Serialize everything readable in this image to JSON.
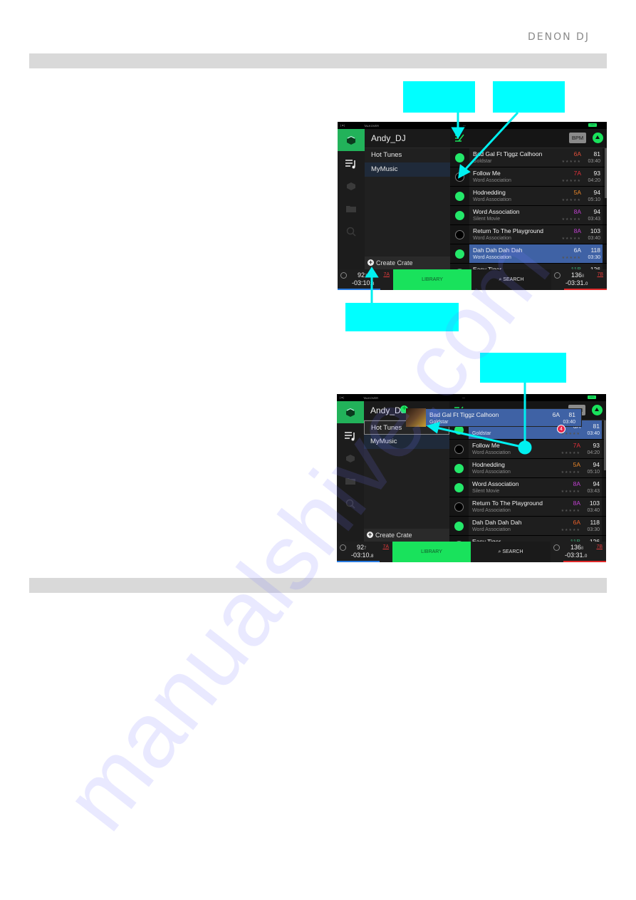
{
  "brand": {
    "logo": "DENON DJ"
  },
  "screens": [
    {
      "status": {
        "left": "|◂|",
        "talkover": "TALKOVER",
        "middle": "—",
        "battery": "100%"
      },
      "user": "Andy_DJ",
      "crates": [
        {
          "label": "Hot Tunes"
        },
        {
          "label": "MyMusic"
        }
      ],
      "create_crate": "Create Crate",
      "bpm_sort": "BPM",
      "tracks": [
        {
          "title": "Bad Gal Ft Tiggz Calhoon",
          "artist": "Goldstar",
          "key": "6A",
          "key_color": "#e0503a",
          "bpm": "81",
          "length": "03:40",
          "checked": true
        },
        {
          "title": "Follow Me",
          "artist": "Word Association",
          "key": "7A",
          "key_color": "#e0303a",
          "bpm": "93",
          "length": "04:20",
          "checked": false
        },
        {
          "title": "Hodnedding",
          "artist": "Word Association",
          "key": "5A",
          "key_color": "#e8862a",
          "bpm": "94",
          "length": "05:10",
          "checked": true
        },
        {
          "title": "Word Association",
          "artist": "Silent Movie",
          "key": "8A",
          "key_color": "#c040d0",
          "bpm": "94",
          "length": "03:43",
          "checked": true
        },
        {
          "title": "Return To The Playground",
          "artist": "Word Association",
          "key": "8A",
          "key_color": "#c040d0",
          "bpm": "103",
          "length": "03:40",
          "checked": false
        },
        {
          "title": "Dah Dah Dah Dah",
          "artist": "Word Association",
          "key": "6A",
          "key_color": "#e6ecf8",
          "bpm": "118",
          "length": "03:30",
          "checked": true,
          "selected": true
        },
        {
          "title": "Easy Tiger",
          "artist": "",
          "key": "11B",
          "key_color": "#3aa070",
          "bpm": "126",
          "length": "",
          "checked": false
        }
      ],
      "deck_left": {
        "bpm": "92",
        "bpm_dec": "7",
        "time": "-03:10.",
        "time_dec": "8",
        "key": "7A",
        "bar_color": "#2a7be0"
      },
      "library": "LIBRARY",
      "search": "SEARCH",
      "deck_right": {
        "bpm": "136",
        "bpm_dec": "8",
        "time": "-03:31.",
        "time_dec": "0",
        "key": "7B",
        "bar_color": "#e02a2a"
      }
    },
    {
      "status": {
        "left": "|◂|",
        "talkover": "TALKOVER",
        "middle": "—",
        "battery": "100%"
      },
      "user": "Andy_DJ",
      "crates": [
        {
          "label": "Hot Tunes"
        },
        {
          "label": "MyMusic"
        }
      ],
      "create_crate": "Create Crate",
      "bpm_sort": "BPM",
      "drag": {
        "title": "Bad Gal Ft Tiggz Calhoon",
        "artist": "Goldstar",
        "key": "6A",
        "bpm": "81",
        "length": "03:40",
        "count": "4"
      },
      "tracks": [
        {
          "title": "",
          "artist": "Goldstar",
          "key": "6A",
          "key_color": "#e6ecf8",
          "bpm": "81",
          "length": "03:40",
          "checked": true,
          "selected": true
        },
        {
          "title": "Follow Me",
          "artist": "Word Association",
          "key": "7A",
          "key_color": "#e0303a",
          "bpm": "93",
          "length": "04:20",
          "checked": false
        },
        {
          "title": "Hodnedding",
          "artist": "Word Association",
          "key": "5A",
          "key_color": "#e8862a",
          "bpm": "94",
          "length": "05:10",
          "checked": true
        },
        {
          "title": "Word Association",
          "artist": "Silent Movie",
          "key": "8A",
          "key_color": "#c040d0",
          "bpm": "94",
          "length": "03:43",
          "checked": true
        },
        {
          "title": "Return To The Playground",
          "artist": "Word Association",
          "key": "8A",
          "key_color": "#c040d0",
          "bpm": "103",
          "length": "03:40",
          "checked": false
        },
        {
          "title": "Dah Dah Dah Dah",
          "artist": "Word Association",
          "key": "6A",
          "key_color": "#e8602a",
          "bpm": "118",
          "length": "03:30",
          "checked": true
        },
        {
          "title": "Easy Tiger",
          "artist": "",
          "key": "11B",
          "key_color": "#3aa070",
          "bpm": "126",
          "length": "",
          "checked": false
        }
      ],
      "deck_left": {
        "bpm": "92",
        "bpm_dec": "7",
        "time": "-03:10.",
        "time_dec": "8",
        "key": "7A",
        "bar_color": "#2a7be0"
      },
      "library": "LIBRARY",
      "search": "SEARCH",
      "deck_right": {
        "bpm": "136",
        "bpm_dec": "8",
        "time": "-03:31.",
        "time_dec": "0",
        "key": "7B",
        "bar_color": "#e02a2a"
      }
    }
  ],
  "watermark": "manualshive.com",
  "colors": {
    "callout": "#00ffff",
    "accent_green": "#19e25c",
    "section_bar": "#d9d9d9"
  }
}
